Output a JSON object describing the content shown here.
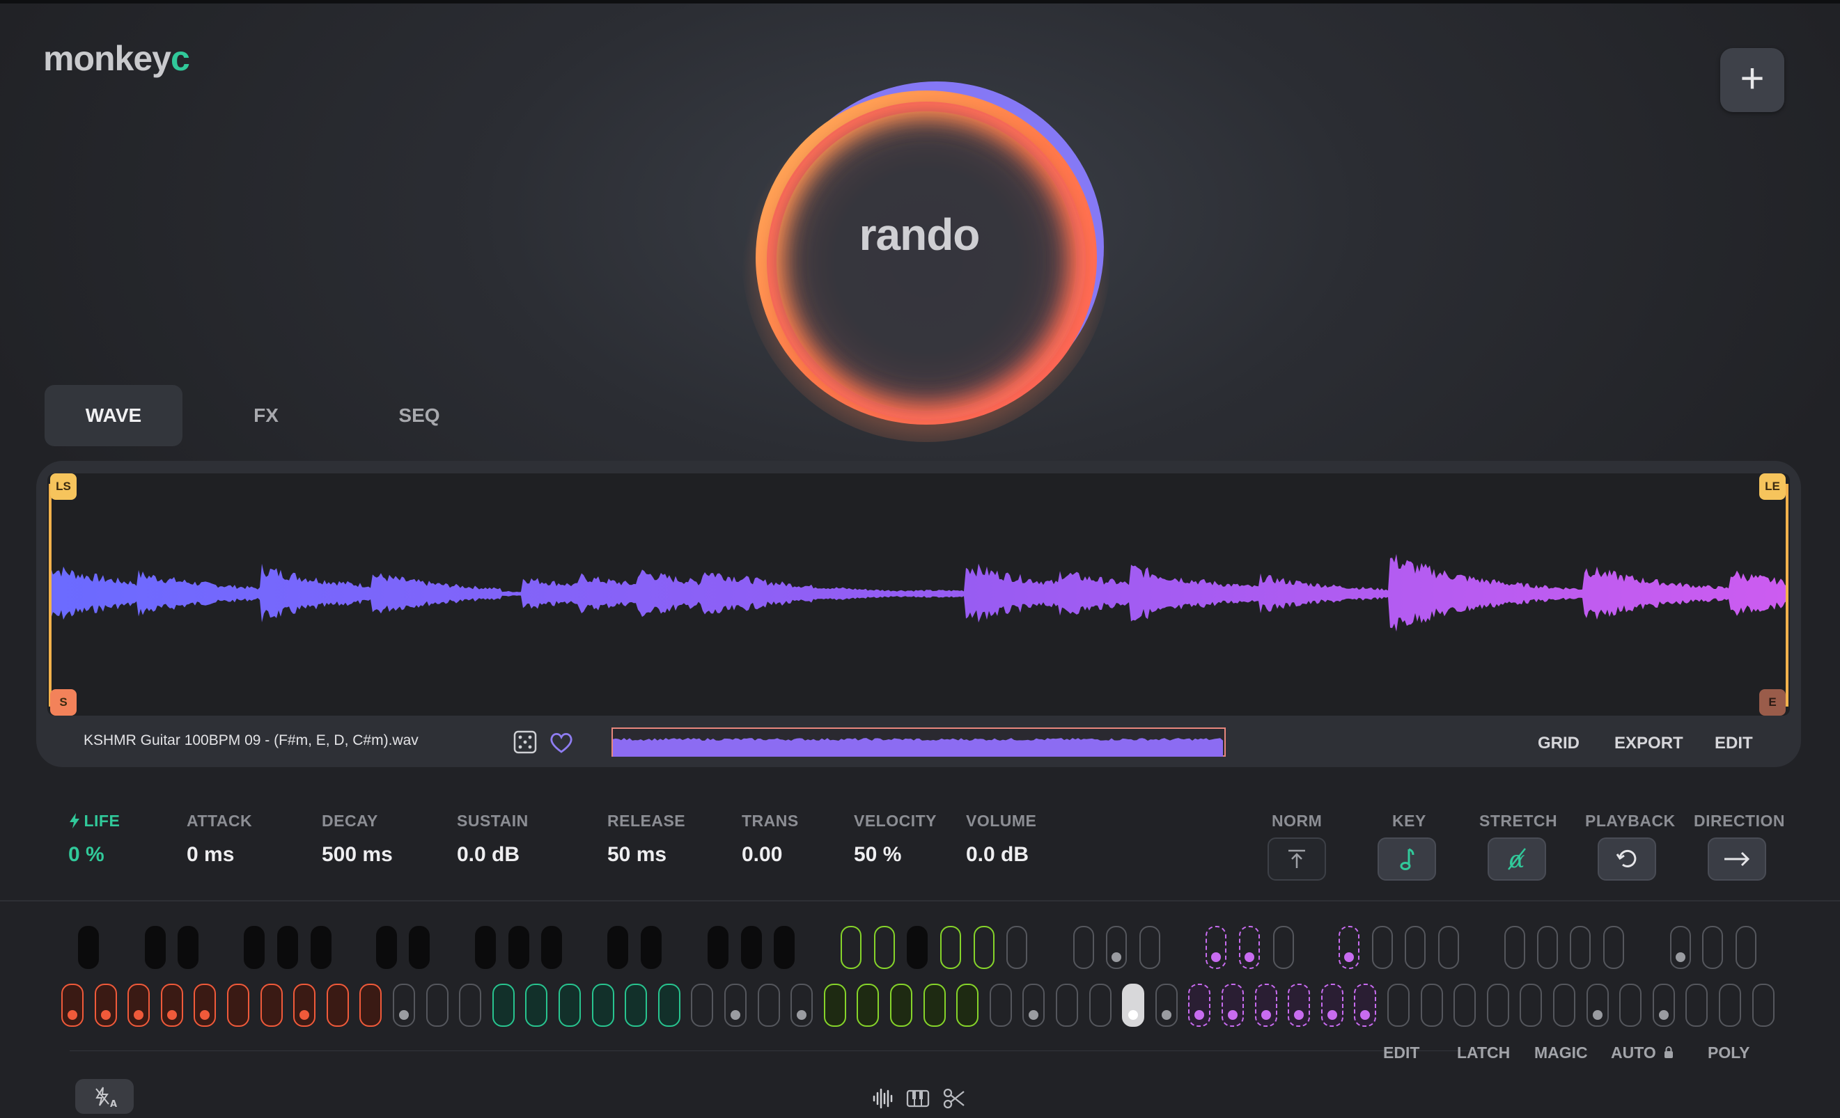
{
  "app": {
    "logo_main": "monkey",
    "logo_accent": "c",
    "orb_label": "rando"
  },
  "tabs": [
    {
      "label": "WAVE",
      "active": true
    },
    {
      "label": "FX",
      "active": false
    },
    {
      "label": "SEQ",
      "active": false
    }
  ],
  "wave": {
    "markers": {
      "loop_start": "LS",
      "loop_end": "LE",
      "start": "S",
      "end": "E"
    },
    "file_name": "KSHMR Guitar 100BPM 09 - (F#m, E, D, C#m).wav",
    "buttons": {
      "grid": "GRID",
      "export": "EXPORT",
      "edit": "EDIT"
    }
  },
  "params": [
    {
      "label": "LIFE",
      "value": "0 %",
      "highlight": true
    },
    {
      "label": "ATTACK",
      "value": "0 ms"
    },
    {
      "label": "DECAY",
      "value": "500 ms"
    },
    {
      "label": "SUSTAIN",
      "value": "0.0 dB"
    },
    {
      "label": "RELEASE",
      "value": "50 ms"
    },
    {
      "label": "TRANS",
      "value": "0.00"
    },
    {
      "label": "VELOCITY",
      "value": "50 %"
    },
    {
      "label": "VOLUME",
      "value": "0.0 dB"
    }
  ],
  "modes": [
    {
      "label": "NORM",
      "icon": "arrow-up-to-line-icon"
    },
    {
      "label": "KEY",
      "icon": "music-note-icon"
    },
    {
      "label": "STRETCH",
      "icon": "alpha-icon"
    },
    {
      "label": "PLAYBACK",
      "icon": "loop-icon"
    },
    {
      "label": "DIRECTION",
      "icon": "arrow-right-icon"
    }
  ],
  "keyboard_controls": {
    "edit": "EDIT",
    "latch": "LATCH",
    "magic": "MAGIC",
    "auto": "AUTO",
    "poly": "POLY"
  },
  "colors": {
    "accent": "#31c99a",
    "orange": "#f05a3a",
    "teal": "#28c48f",
    "lime": "#86d42a",
    "purple": "#c86cf0",
    "wave_start": "#6b6bff",
    "wave_end": "#cc5cf0"
  }
}
